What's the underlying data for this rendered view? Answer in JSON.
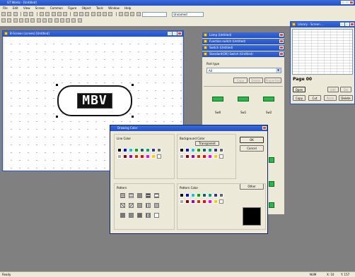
{
  "app": {
    "title": "GT Works - [Untitled]"
  },
  "menu": {
    "items": [
      "File",
      "Edit",
      "View",
      "Screen",
      "Common",
      "Figure",
      "Object",
      "Tools",
      "Window",
      "Help"
    ]
  },
  "toolbar": {
    "combo1_value": "",
    "combo2_value": "Unnamed"
  },
  "base_window": {
    "title": "B-Screen (screen) [Untitled]"
  },
  "canvas": {
    "lamp_text": "MBV"
  },
  "right_panels": [
    {
      "label": "Lamp (Untitled)"
    },
    {
      "label": "Function switch (Untitled)"
    },
    {
      "label": "Switch (Untitled)"
    },
    {
      "label": "Standard(OK) Switch (Untitled)"
    }
  ],
  "parts_panel": {
    "label": "Part type",
    "select_value": "All",
    "buttons": [
      "Copy",
      "Delete",
      "Properties"
    ],
    "switch_labels": [
      "Sw0",
      "Sw1",
      "Sw2"
    ]
  },
  "page_window": {
    "title": "Library - Screen ...",
    "page_label": "Page 00",
    "open_label": "Open",
    "buttons_row1": [
      "Open",
      "",
      "Edit",
      "Del"
    ],
    "buttons_row2": [
      "Copy",
      "Cut",
      "Paste",
      "Delete"
    ]
  },
  "dialog": {
    "title": "Drawing Color",
    "ok_label": "OK",
    "cancel_label": "Cancel",
    "other_label": "Other",
    "line_color_label": "Line Color",
    "background_color_label": "Background Color",
    "transparent_label": "Transparent",
    "pattern_label": "Pattern",
    "pattern_color_label": "Pattern Color",
    "line_colors_row1": [
      "#000000",
      "#0000ff",
      "#00cccc",
      "#00aa00",
      "#006666",
      "#00aa66",
      "#333399",
      "#666666"
    ],
    "line_colors_row2": [
      "#aaaaaa",
      "#880000",
      "#aa00aa",
      "#cc3300",
      "#ff0000",
      "#ff00ff",
      "#ffcc00",
      "#ffffff"
    ],
    "bg_colors_row1": [
      "#000000",
      "#0000ff",
      "#00cccc",
      "#00aa00",
      "#006666",
      "#00aa66",
      "#333399",
      "#666666"
    ],
    "bg_colors_row2": [
      "#aaaaaa",
      "#880000",
      "#aa00aa",
      "#cc3300",
      "#ff0000",
      "#ff00ff",
      "#ffcc00",
      "#ffffff"
    ],
    "pc_colors_row1": [
      "#000000",
      "#0000ff",
      "#00cccc",
      "#00aa00",
      "#006666",
      "#00aa66",
      "#333399",
      "#666666"
    ],
    "pc_colors_row2": [
      "#aaaaaa",
      "#880000",
      "#aa00aa",
      "#cc3300",
      "#ff0000",
      "#ff00ff",
      "#ffcc00",
      "#ffffff"
    ],
    "preview_color": "#000000"
  },
  "status": {
    "left": "Ready",
    "right1": "NUM",
    "right2": "X: 10",
    "right3": "Y: 157"
  }
}
